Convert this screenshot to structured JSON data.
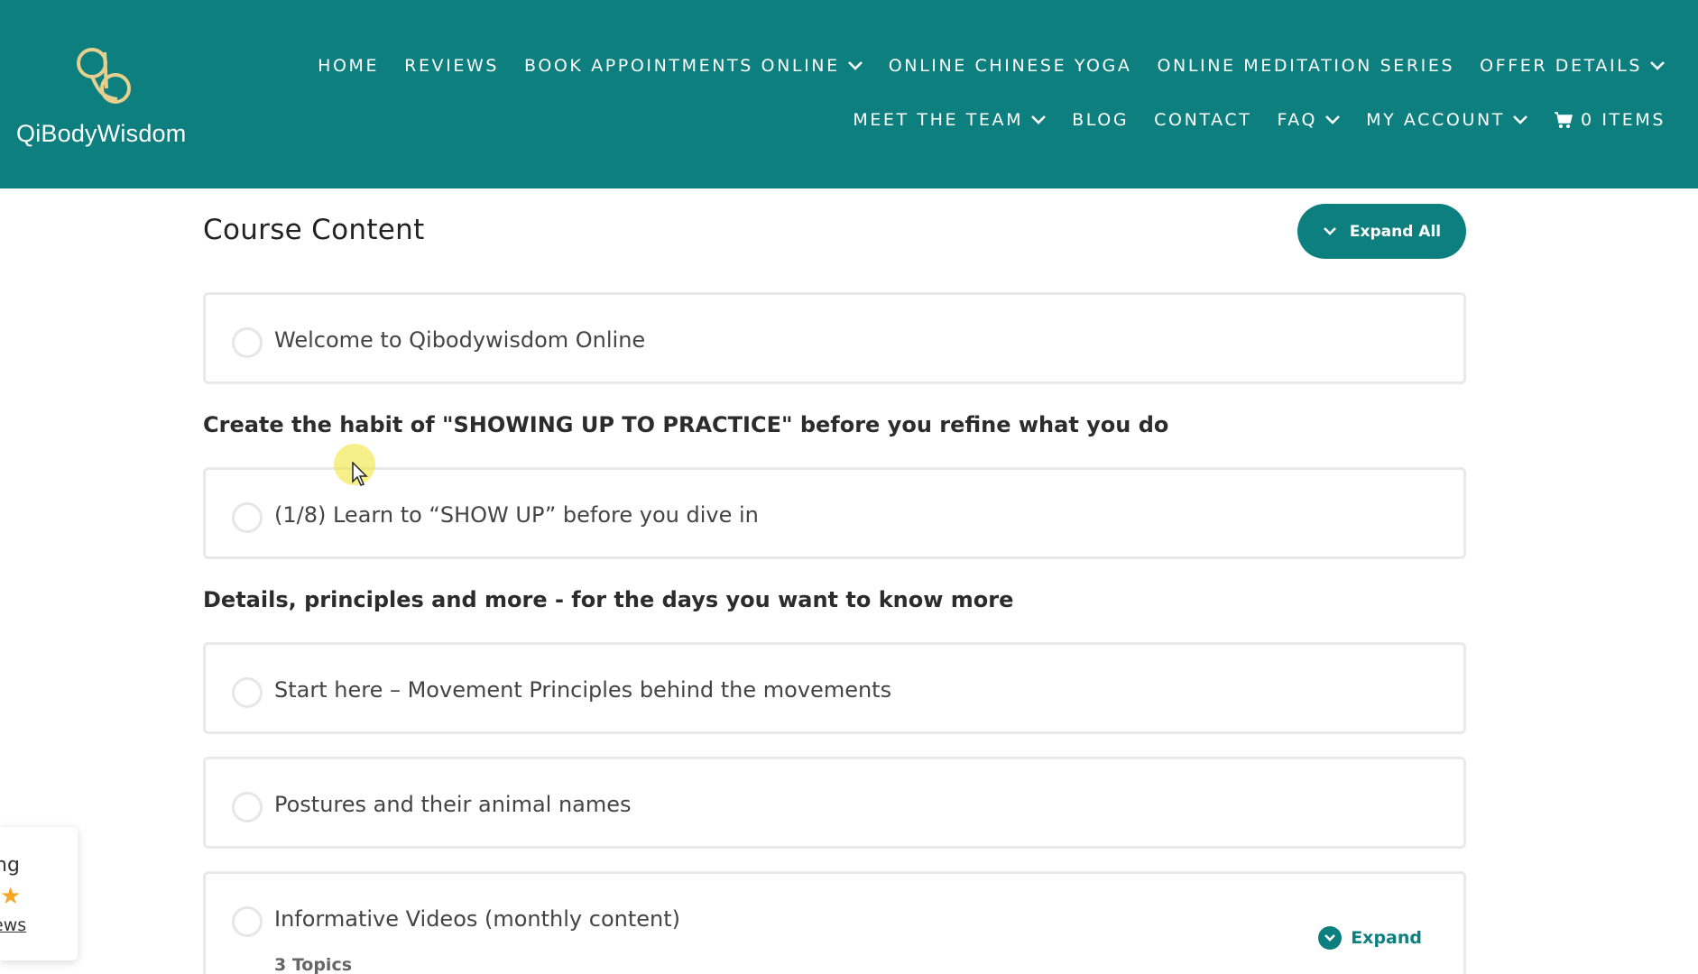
{
  "header": {
    "brand": "QiBodyWisdom",
    "nav_row1": [
      {
        "label": "HOME",
        "dropdown": false
      },
      {
        "label": "REVIEWS",
        "dropdown": false
      },
      {
        "label": "BOOK APPOINTMENTS ONLINE",
        "dropdown": true
      },
      {
        "label": "ONLINE CHINESE YOGA",
        "dropdown": false
      },
      {
        "label": "ONLINE MEDITATION SERIES",
        "dropdown": false
      },
      {
        "label": "OFFER DETAILS",
        "dropdown": true
      }
    ],
    "nav_row2": [
      {
        "label": "MEET THE TEAM",
        "dropdown": true
      },
      {
        "label": "BLOG",
        "dropdown": false
      },
      {
        "label": "CONTACT",
        "dropdown": false
      },
      {
        "label": "FAQ",
        "dropdown": true
      },
      {
        "label": "MY ACCOUNT",
        "dropdown": true
      }
    ],
    "cart_label": "0 ITEMS"
  },
  "course": {
    "title": "Course Content",
    "expand_all_label": "Expand All",
    "lessons": [
      {
        "label": "Welcome to Qibodywisdom Online"
      },
      {
        "label": "(1/8) Learn to “SHOW UP” before you dive in"
      },
      {
        "label": "Start here – Movement Principles behind the movements"
      },
      {
        "label": "Postures and their animal names"
      },
      {
        "label": "Informative Videos (monthly content)",
        "topics": "3 Topics",
        "expand_label": "Expand"
      }
    ],
    "sections": [
      {
        "heading": "Create the habit of \"SHOWING UP TO PRACTICE\" before you refine what you do"
      },
      {
        "heading": "Details, principles and more - for the days you want to know more"
      }
    ]
  },
  "reviews_widget": {
    "line1": "ng",
    "stars": "★",
    "line3": "ews"
  },
  "colors": {
    "brand_teal": "#0e7f7f",
    "star": "#f5a623"
  }
}
